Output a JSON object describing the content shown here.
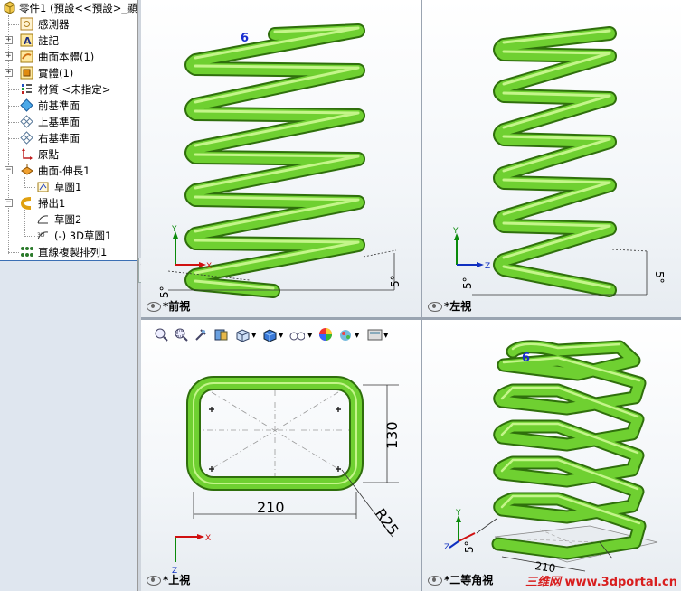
{
  "feature_tree": {
    "root": "零件1 (預設<<預設>_顯",
    "items": [
      {
        "label": "感測器",
        "icon": "sensor-icon",
        "expandable": false
      },
      {
        "label": "註記",
        "icon": "annotation-icon",
        "expandable": true
      },
      {
        "label": "曲面本體(1)",
        "icon": "surface-body-icon",
        "expandable": true
      },
      {
        "label": "實體(1)",
        "icon": "solid-body-icon",
        "expandable": true
      },
      {
        "label": "材質 <未指定>",
        "icon": "material-icon",
        "expandable": false
      },
      {
        "label": "前基準面",
        "icon": "front-plane-icon",
        "expandable": false
      },
      {
        "label": "上基準面",
        "icon": "top-plane-icon",
        "expandable": false
      },
      {
        "label": "右基準面",
        "icon": "right-plane-icon",
        "expandable": false
      },
      {
        "label": "原點",
        "icon": "origin-icon",
        "expandable": false
      },
      {
        "label": "曲面-伸長1",
        "icon": "surface-extrude-icon",
        "expandable": true
      },
      {
        "label": "草圖1",
        "icon": "sketch-icon",
        "expandable": false
      },
      {
        "label": "掃出1",
        "icon": "sweep-icon",
        "expandable": true
      },
      {
        "label": "草圖2",
        "icon": "sketch-icon",
        "expandable": false
      },
      {
        "label": "(-) 3D草圖1",
        "icon": "3d-sketch-icon",
        "expandable": false
      },
      {
        "label": "直線複製排列1",
        "icon": "linear-pattern-icon",
        "expandable": false
      }
    ]
  },
  "viewports": {
    "front": {
      "label": "*前視",
      "annotation": "6",
      "angle_left": "5°",
      "angle_right": "5°"
    },
    "left": {
      "label": "*左視",
      "angle_left": "5°",
      "angle_right": "5°"
    },
    "top": {
      "label": "*上視",
      "dim_width": "210",
      "dim_height": "130",
      "dim_radius": "R25"
    },
    "iso": {
      "label": "*二等角視",
      "annotation": "6",
      "angle": "5°",
      "dim_bottom": "210"
    }
  },
  "axes": {
    "x": "X",
    "y": "Y",
    "z": "Z"
  },
  "toolbar_icons": [
    "zoom-to-fit-icon",
    "zoom-area-icon",
    "previous-view-icon",
    "section-view-icon",
    "view-orientation-icon",
    "display-style-icon",
    "hide-show-icon",
    "edit-appearance-icon",
    "apply-scene-icon",
    "view-settings-icon"
  ],
  "watermark": {
    "prefix": "三维网",
    "url": "www.3dportal.cn"
  },
  "colors": {
    "spring": "#6fd031",
    "spring_dark": "#3f8f14",
    "spring_light": "#b6f07a",
    "axis_x": "#d01010",
    "axis_y": "#0a8a0a",
    "axis_z": "#1030c0",
    "annotation": "#1a2fd0"
  }
}
